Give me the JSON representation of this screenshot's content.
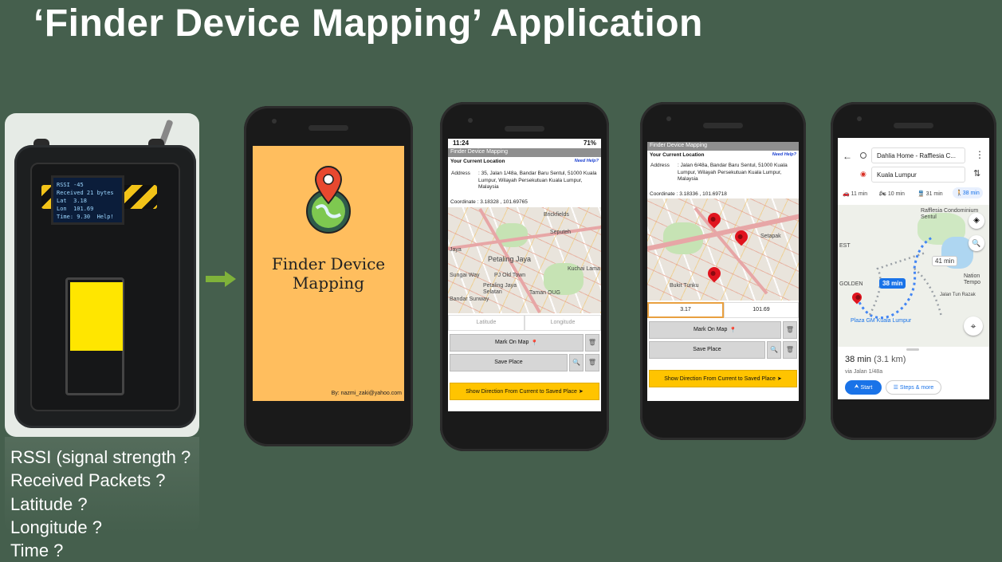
{
  "title": "‘Finder Device Mapping’ Application",
  "device": {
    "oled_lines": [
      "RSSI -45",
      "Received 21 bytes",
      "Lat  3.18",
      "Lon  101.69",
      "Time: 9.30  Help!"
    ]
  },
  "questions": [
    "RSSI (signal strength ?",
    "Received Packets ?",
    "Latitude ?",
    "Longitude ?",
    "Time ?"
  ],
  "colors": {
    "background": "#455f4d",
    "splash": "#ffbe5e",
    "accent_yellow": "#ffc400",
    "arrow": "#7fb23a"
  },
  "splash": {
    "title_line1": "Finder Device",
    "title_line2": "Mapping",
    "credit": "By: nazmi_zaki@yahoo.com",
    "logo_icon": "map-pin-globe-icon"
  },
  "screen2": {
    "status_time": "11:24",
    "status_right": "71%",
    "app_title": "Finder Device Mapping",
    "section": "Your Current Location",
    "help": "Need Help?",
    "address_label": "Address",
    "address_value": ": 35, Jalan 1/48a, Bandar Baru Sentul, 51000 Kuala Lumpur, Wilayah Persekutuan Kuala Lumpur, Malaysia",
    "coordinate": "Coordinate : 3.18328 , 101.69765",
    "map_labels": [
      "Brickfields",
      "Seputeh",
      "Petaling Jaya",
      "Kuchai Lama",
      "PJ Old Town",
      "Sungai Way",
      "Petaling Jaya Selatan",
      "Taman OUG",
      "Bandar Sunway",
      "Jaya"
    ],
    "latitude_placeholder": "Latitude",
    "longitude_placeholder": "Longitude",
    "mark_on_map": "Mark On Map",
    "save_place": "Save Place",
    "show_direction": "Show Direction From Current to Saved Place ➤"
  },
  "screen3": {
    "app_title": "Finder Device Mapping",
    "section": "Your Current Location",
    "help": "Need Help?",
    "address_label": "Address",
    "address_value": ": Jalan 6/48a, Bandar Baru Sentul, 51000 Kuala Lumpur, Wilayah Persekutuan Kuala Lumpur, Malaysia",
    "coordinate": "Coordinate : 3.18336 , 101.69718",
    "map_labels": [
      "Setapak",
      "Bukit Tunku"
    ],
    "latitude_value": "3.17",
    "longitude_value": "101.69",
    "mark_on_map": "Mark On Map",
    "save_place": "Save Place",
    "show_direction": "Show Direction From Current to Saved Place ➤"
  },
  "screen4": {
    "from": "Dahlia Home - Rafflesia C...",
    "to": "Kuala Lumpur",
    "modes": [
      "11 min",
      "10 min",
      "31 min",
      "38 min"
    ],
    "map_labels": [
      "Rafflesia Condominium Sentul",
      "EST",
      "GOLDEN",
      "Nation Tempo",
      "Jalan Tun Razak",
      "Plaza GM Kuala Lumpur"
    ],
    "chip_38": "38 min",
    "chip_41": "41 min",
    "duration": "38 min",
    "distance": "(3.1 km)",
    "via": "via Jalan 1/48a",
    "start": "Start",
    "steps": "Steps & more"
  }
}
